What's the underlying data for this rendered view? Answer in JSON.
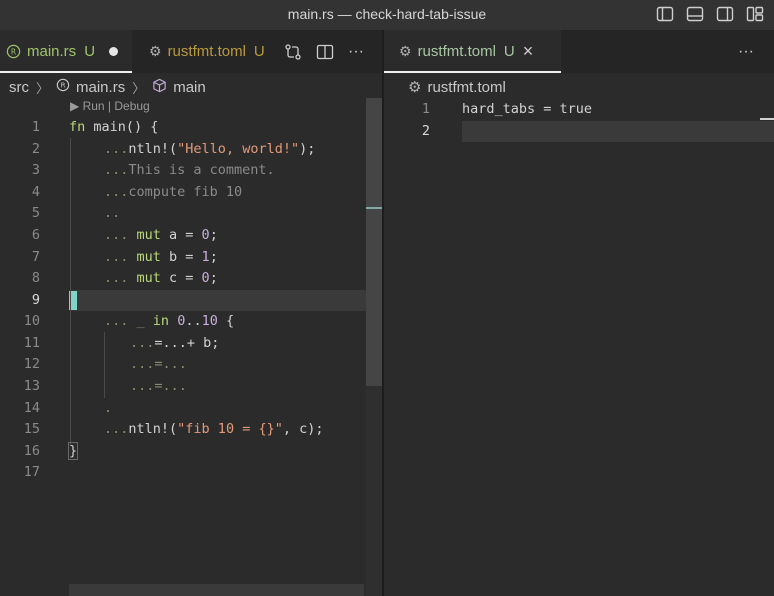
{
  "window": {
    "title": "main.rs — check-hard-tab-issue"
  },
  "left_tabs": [
    {
      "label": "main.rs",
      "status": "U",
      "dirty": true
    },
    {
      "label": "rustfmt.toml",
      "status": "U"
    }
  ],
  "right_tabs": [
    {
      "label": "rustfmt.toml",
      "status": "U",
      "close": "×"
    }
  ],
  "breadcrumb_left": {
    "folder": "src",
    "file": "main.rs",
    "symbol": "main"
  },
  "breadcrumb_right": {
    "file": "rustfmt.toml"
  },
  "codelens": "▶ Run | Debug",
  "left_editor": {
    "lines": [
      {
        "n": "1"
      },
      {
        "n": "2"
      },
      {
        "n": "3"
      },
      {
        "n": "4"
      },
      {
        "n": "5"
      },
      {
        "n": "6"
      },
      {
        "n": "7"
      },
      {
        "n": "8"
      },
      {
        "n": "9"
      },
      {
        "n": "10"
      },
      {
        "n": "11"
      },
      {
        "n": "12"
      },
      {
        "n": "13"
      },
      {
        "n": "14"
      },
      {
        "n": "15"
      },
      {
        "n": "16"
      },
      {
        "n": "17"
      }
    ],
    "code": {
      "l1a": "fn",
      "l1b": " main() {",
      "l2a": "...",
      "l2b": "ntln!(",
      "l2c": "\"Hello, world!\"",
      "l2d": ");",
      "l3a": "...",
      "l3b": "This is a comment.",
      "l4a": "...",
      "l4b": "compute fib 10",
      "l5": "..",
      "l6a": "... ",
      "l6b": "mut",
      "l6c": " a = ",
      "l6d": "0",
      "l6e": ";",
      "l7a": "... ",
      "l7b": "mut",
      "l7c": " b = ",
      "l7d": "1",
      "l7e": ";",
      "l8a": "... ",
      "l8b": "mut",
      "l8c": " c = ",
      "l8d": "0",
      "l8e": ";",
      "l10a": "... _ ",
      "l10b": "in",
      "l10c": " ",
      "l10d": "0",
      "l10e": "..",
      "l10f": "10",
      "l10g": " {",
      "l11a": "...",
      "l11b": "=...+ b;",
      "l12": "...=...",
      "l13": "...=...",
      "l14": ".",
      "l15a": "...",
      "l15b": "ntln!(",
      "l15c": "\"fib 10 = {}\"",
      "l15d": ", c);",
      "l16": "}"
    }
  },
  "right_editor": {
    "lines": [
      {
        "n": "1"
      },
      {
        "n": "2"
      }
    ],
    "code": {
      "r1a": "hard_tabs",
      "r1b": " = ",
      "r1c": "true"
    }
  },
  "icons": [
    "split-layout-icon",
    "panel-icon",
    "sidebar-icon",
    "customize-layout-icon",
    "gear-icon",
    "rust-icon",
    "compare-changes-icon",
    "split-editor-icon",
    "more-actions-icon",
    "close-icon",
    "symbol-cube-icon"
  ],
  "colors": {
    "added_green": "#9fc56a",
    "cursor": "#7fd3c8"
  }
}
